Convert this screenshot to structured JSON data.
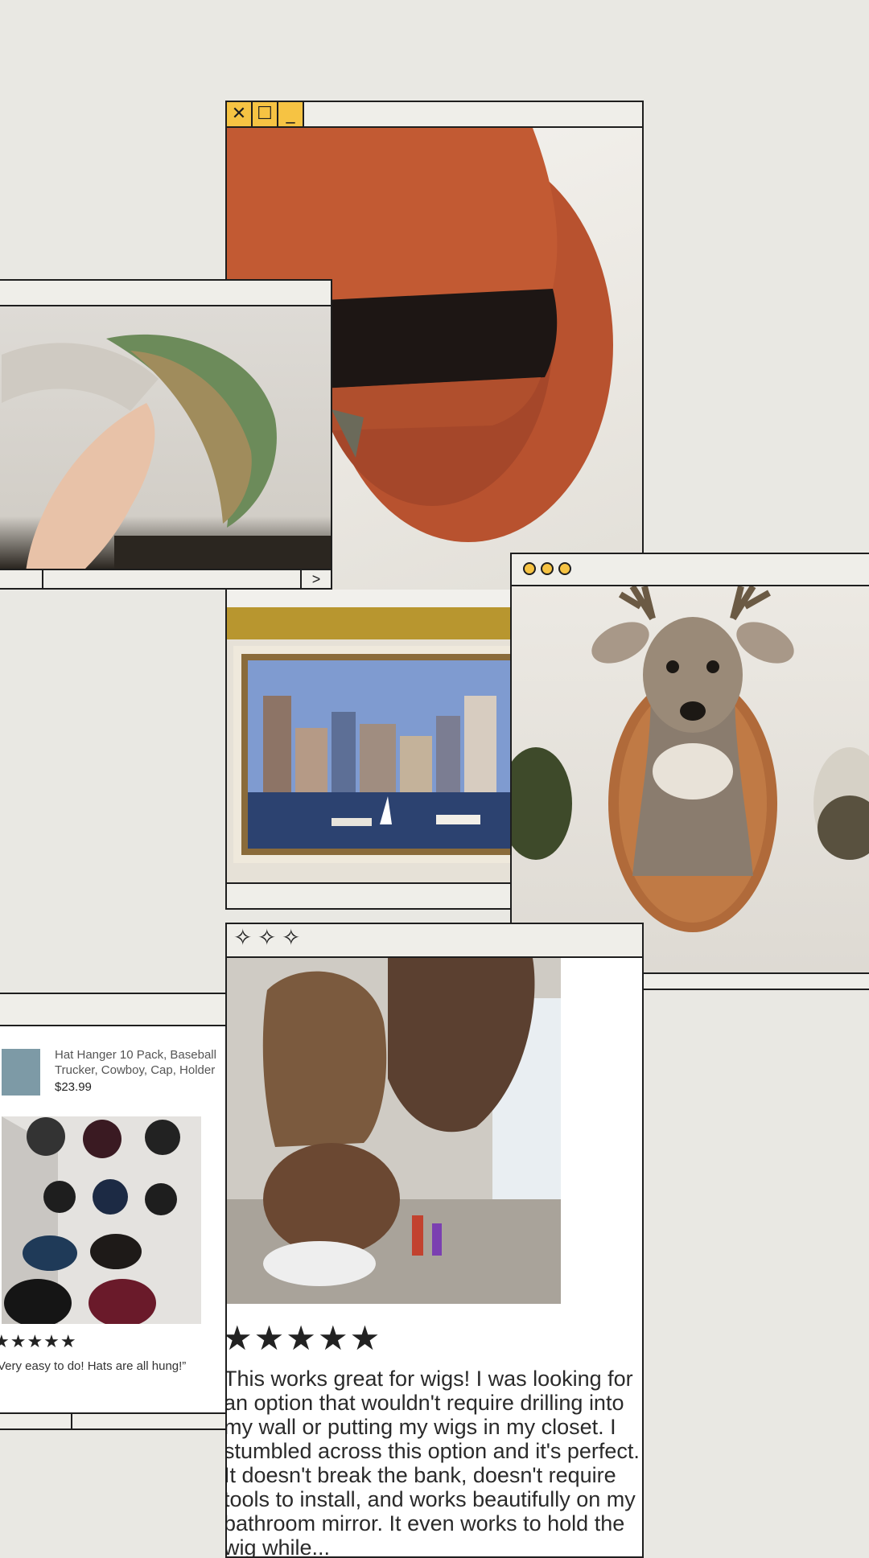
{
  "windows": {
    "hat": {
      "controls": [
        "✕",
        "☐",
        "_"
      ]
    },
    "paper_hat": {
      "next_label": ">"
    },
    "deer": {
      "prev_label": "◀"
    },
    "wig_review": {
      "stars": "★★★★★",
      "review_text": "This works great for wigs! I was looking for an option that wouldn't require drilling into my wall or putting my wigs in my closet. I stumbled across this option and it's perfect. It doesn't break the bank, doesn't require tools to install, and works beautifully on my bathroom mirror. It even works to hold the wig while..."
    },
    "product": {
      "title": "Hat Hanger 10 Pack, Baseball Trucker, Cowboy, Cap, Holder",
      "price": "$23.99",
      "stars": "★★★★★",
      "review_text": "“Very easy to do! Hats are all hung!”"
    }
  },
  "colors": {
    "accent": "#f6c343",
    "border": "#1e1e1e",
    "background": "#e9e8e3"
  }
}
